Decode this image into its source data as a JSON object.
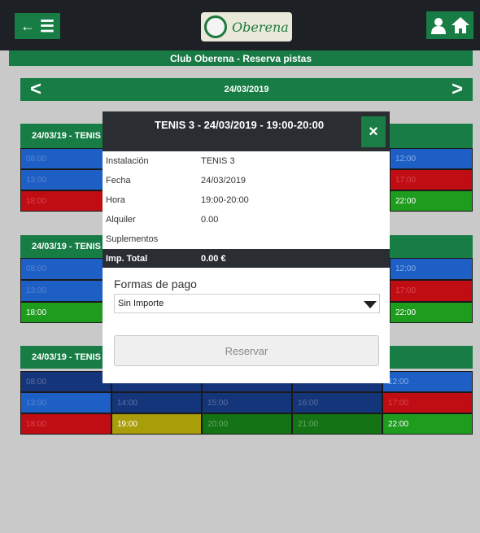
{
  "app": {
    "logo_text": "Oberena",
    "title": "Club Oberena - Reserva pistas"
  },
  "header": {
    "back_icon": "arrow-left-icon",
    "menu_icon": "hamburger-menu-icon",
    "user_icon": "user-icon",
    "home_icon": "home-icon"
  },
  "datebar": {
    "date": "24/03/2019",
    "prev": "<",
    "next": ">"
  },
  "courts": [
    {
      "title": "24/03/19 - TENIS",
      "rows": [
        {
          "left": "08:00",
          "right": "12:00"
        },
        {
          "left": "13:00",
          "right": "17:00"
        },
        {
          "left": "18:00",
          "right": "22:00"
        }
      ]
    },
    {
      "title": "24/03/19 - TENIS",
      "rows": [
        {
          "left": "08:00",
          "right": "12:00"
        },
        {
          "left": "13:00",
          "right": "17:00"
        },
        {
          "left": "18:00",
          "right": "22:00"
        }
      ]
    },
    {
      "title": "24/03/19 - TENIS",
      "rows": [
        {
          "cells": [
            "08:00",
            "",
            "",
            "",
            "12:00"
          ]
        },
        {
          "cells": [
            "13:00",
            "14:00",
            "15:00",
            "16:00",
            "17:00"
          ]
        },
        {
          "cells": [
            "18:00",
            "19:00",
            "20:00",
            "21:00",
            "22:00"
          ]
        }
      ]
    }
  ],
  "modal": {
    "title": "TENIS 3 - 24/03/2019 - 19:00-20:00",
    "close": "×",
    "rows": [
      {
        "label": "Instalación",
        "value": "TENIS 3"
      },
      {
        "label": "Fecha",
        "value": "24/03/2019"
      },
      {
        "label": "Hora",
        "value": "19:00-20:00"
      },
      {
        "label": "Alquiler",
        "value": "0.00"
      },
      {
        "label": "Suplementos",
        "value": ""
      }
    ],
    "total_label": "Imp. Total",
    "total_value": "0.00 €",
    "payment_label": "Formas de pago",
    "payment_selected": "Sin Importe",
    "reserve_label": "Reservar"
  }
}
